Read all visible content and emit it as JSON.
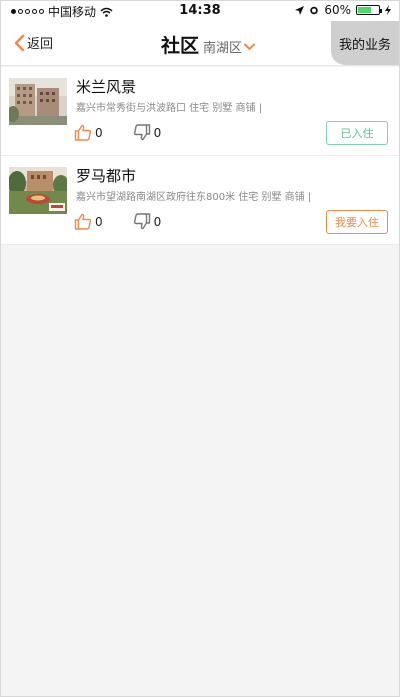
{
  "status": {
    "carrier": "中国移动",
    "time": "14:38",
    "battery": "60%"
  },
  "nav": {
    "back_label": "返回",
    "title": "社区",
    "region": "南湖区",
    "my_business": "我的业务",
    "accent": "#f08a4b"
  },
  "communities": [
    {
      "name": "米兰风景",
      "address": "嘉兴市常秀街与洪波路口  住宅 别墅 商铺 |",
      "likes": "0",
      "dislikes": "0",
      "action": "已入住",
      "action_color": "#5cc294"
    },
    {
      "name": "罗马都市",
      "address": "嘉兴市望湖路南湖区政府往东800米  住宅 别墅 商铺 |",
      "likes": "0",
      "dislikes": "0",
      "action": "我要入住",
      "action_color": "#f08a4b"
    }
  ]
}
